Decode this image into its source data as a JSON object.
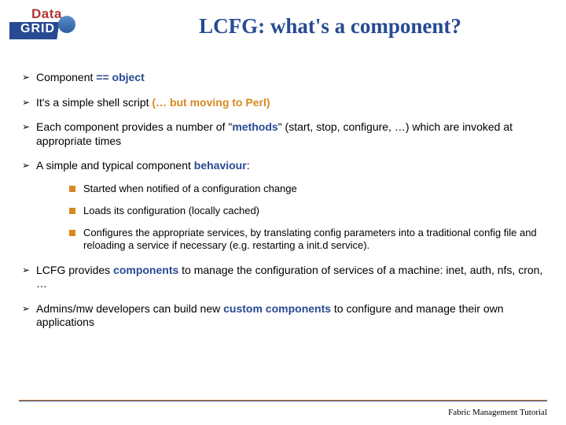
{
  "logo": {
    "top": "Data",
    "bottom": "GRID"
  },
  "title": "LCFG: what's a component?",
  "bullets": [
    {
      "pre": "Component ",
      "hl": "== object",
      "hlClass": "hl-blue",
      "post": ""
    },
    {
      "pre": "It's a simple shell script ",
      "hl": "(… but moving to Perl)",
      "hlClass": "hl-orange",
      "post": ""
    },
    {
      "pre": "Each component provides a number of \"",
      "hl": "methods",
      "hlClass": "hl-blue",
      "post": "\" (start, stop, configure, …) which are invoked at appropriate times"
    },
    {
      "pre": "A simple and typical component ",
      "hl": "behaviour",
      "hlClass": "hl-blue",
      "post": ":"
    }
  ],
  "sub": [
    "Started when notified of a configuration change",
    "Loads its configuration (locally cached)",
    "Configures the appropriate services, by translating config parameters into a traditional config file and reloading a service if necessary (e.g. restarting a init.d service)."
  ],
  "bullets2": [
    {
      "pre": "LCFG provides ",
      "hl": "components",
      "hlClass": "hl-blue",
      "post": " to manage the configuration of services of a machine: inet, auth, nfs, cron, …"
    },
    {
      "pre": "Admins/mw developers can build new ",
      "hl": "custom components",
      "hlClass": "hl-blue",
      "post": " to configure and manage their own applications"
    }
  ],
  "footer": "Fabric Management Tutorial"
}
